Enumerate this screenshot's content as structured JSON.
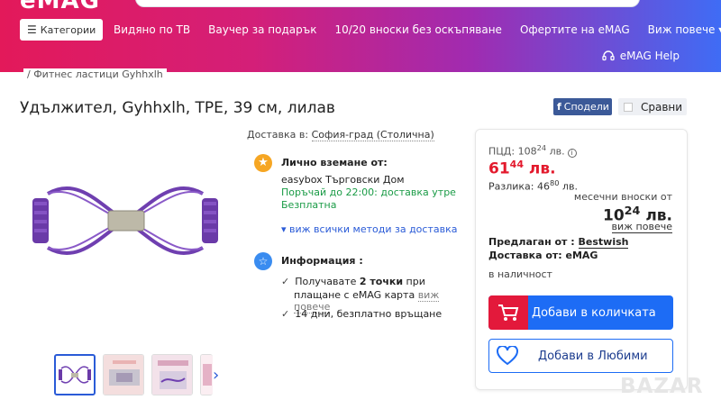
{
  "header": {
    "logo": "eMAG",
    "categories_label": "Категории",
    "nav_items": [
      "Видяно по ТВ",
      "Ваучер за подарък",
      "10/20 вноски без оскъпяване",
      "Офертите на eMAG",
      "Виж повече ▾"
    ],
    "help_label": "eMAG Help"
  },
  "breadcrumb": "/ Фитнес ластици Gyhhxlh",
  "product": {
    "title": "Удължител, Gyhhxlh, TPE, 39 см, лилав",
    "share_label": "Сподели",
    "share_icon": "f",
    "compare_label": "Сравни"
  },
  "delivery": {
    "label": "Доставка в:",
    "location": "София-град (Столична)",
    "pickup_title": "Лично вземане от:",
    "pickup_name": "easybox Търговски Дом",
    "pickup_order": "Поръчай до 22:00: доставка утре",
    "pickup_free": "Безплатна",
    "all_methods": "▾ виж всички методи за доставка",
    "info_title": "Информация :",
    "info_line1_a": "Получавате ",
    "info_line1_b": "2 точки",
    "info_line1_c": " при",
    "info_line2": "плащане с eMAG карта ",
    "info_more": "виж повече",
    "info_line3": "14 дни, безплатно връщане"
  },
  "price": {
    "pcd_label": "ПЦД: 108",
    "pcd_cents": "24",
    "pcd_currency": " лв.",
    "current_main": "61",
    "current_cents": "44",
    "current_currency": " лв.",
    "diff_label": "Разлика: 46",
    "diff_cents": "80",
    "diff_currency": " лв.",
    "installments_label": "месечни вноски от",
    "monthly_main": "10",
    "monthly_cents": "24",
    "monthly_currency": " лв.",
    "see_more": "виж повече",
    "seller_label": "Предлаган от : ",
    "seller_name": "Bestwish",
    "delivered_by": "Доставка от: eMAG",
    "stock": "в наличност",
    "add_to_cart": "Добави в количката",
    "add_to_fav": "Добави в Любими"
  },
  "watermark": "BAZAR",
  "colors": {
    "accent_red": "#e3192c",
    "brand_blue": "#1d6cf5",
    "success_green": "#1a9b46",
    "product_purple": "#6f3fb0"
  }
}
